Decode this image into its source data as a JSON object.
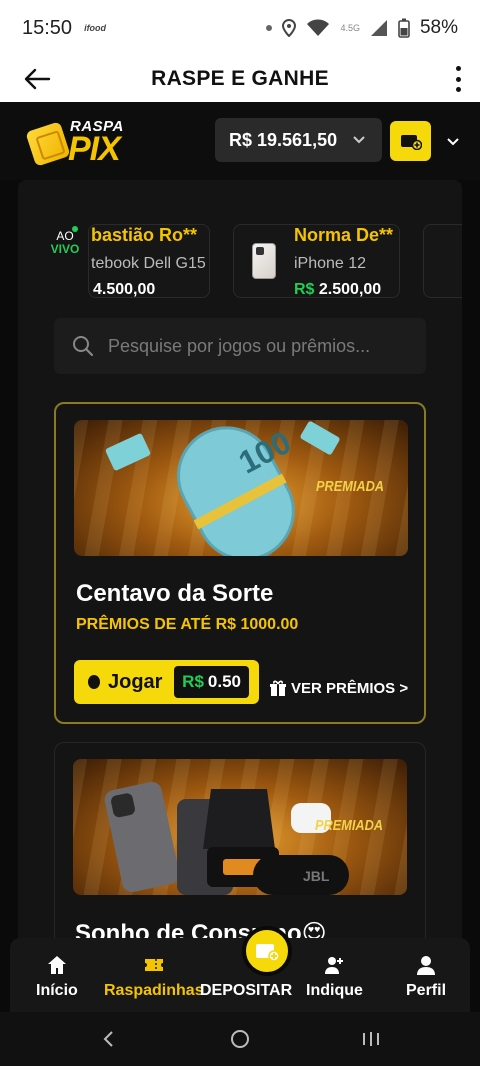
{
  "status_bar": {
    "time": "15:50",
    "notif": "ifood",
    "network": "4.5G",
    "battery": "58%"
  },
  "app_bar": {
    "title": "RASPE E GANHE"
  },
  "header": {
    "logo_top": "RASPA",
    "logo_bottom": "PIX",
    "balance": "R$ 19.561,50"
  },
  "live": {
    "line1": "AO",
    "line2": "VIVO"
  },
  "tickers": [
    {
      "name": "bastião Ro**",
      "prize": "tebook Dell G15",
      "amount": "4.500,00",
      "currency": ""
    },
    {
      "name": "Norma De**",
      "prize": "iPhone 12",
      "amount": "2.500,00",
      "currency": "R$"
    }
  ],
  "search": {
    "placeholder": "Pesquise por jogos ou prêmios..."
  },
  "cards": [
    {
      "title": "Centavo da Sorte",
      "subtitle": "PRÊMIOS DE ATÉ R$ 1000.00",
      "badge": "PREMIADA",
      "play": "Jogar",
      "price_cur": "R$",
      "price": "0.50",
      "link": "VER PRÊMIOS >"
    },
    {
      "title": "Sonho de Consumo😍",
      "badge": "PREMIADA"
    }
  ],
  "nav": [
    {
      "label": "Início",
      "icon": "home-icon"
    },
    {
      "label": "Raspadinhas",
      "icon": "ticket-icon"
    },
    {
      "label": "DEPOSITAR",
      "icon": "wallet-add-icon"
    },
    {
      "label": "Indique",
      "icon": "user-add-icon"
    },
    {
      "label": "Perfil",
      "icon": "user-icon"
    }
  ],
  "colors": {
    "accent": "#f5c400",
    "button_yellow": "#f5d90a",
    "green": "#22cc55",
    "background": "#0a0a0a"
  }
}
